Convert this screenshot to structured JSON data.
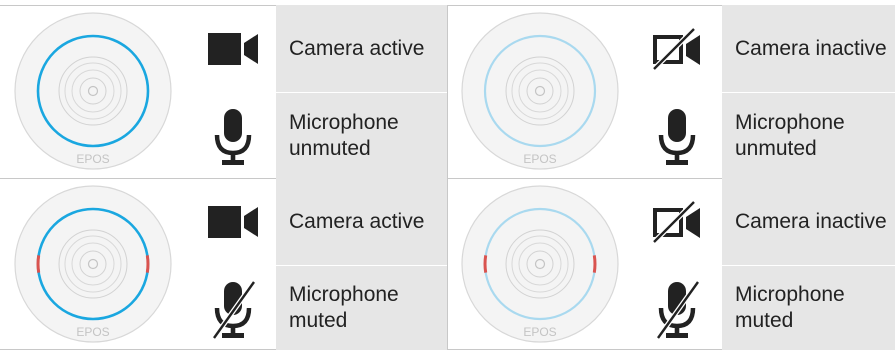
{
  "brand": "EPOS",
  "colors": {
    "ring_active": "#1aa7e0",
    "ring_inactive": "#a9d9ef",
    "mute_marker": "#d9534f",
    "device_body": "#efefef",
    "text_bg": "#e6e6e6"
  },
  "states": [
    {
      "camera_label": "Camera active",
      "camera_icon": "camera-icon",
      "mic_label": "Microphone unmuted",
      "mic_icon": "microphone-icon"
    },
    {
      "camera_label": "Camera inactive",
      "camera_icon": "camera-off-icon",
      "mic_label": "Microphone unmuted",
      "mic_icon": "microphone-icon"
    },
    {
      "camera_label": "Camera active",
      "camera_icon": "camera-icon",
      "mic_label": "Microphone muted",
      "mic_icon": "microphone-muted-icon"
    },
    {
      "camera_label": "Camera inactive",
      "camera_icon": "camera-off-icon",
      "mic_label": "Microphone muted",
      "mic_icon": "microphone-muted-icon"
    }
  ]
}
